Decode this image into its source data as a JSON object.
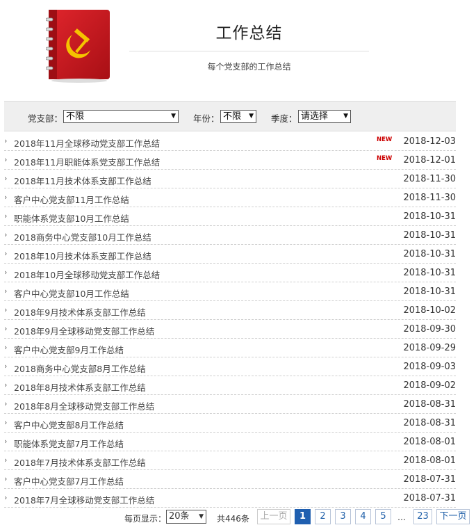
{
  "header": {
    "title": "工作总结",
    "subtitle": "每个党支部的工作总结",
    "logo_icon": "red-notebook-hammer-sickle-icon"
  },
  "filters": {
    "branch_label": "党支部：",
    "branch_value": "不限",
    "year_label": "年份：",
    "year_value": "不限",
    "quarter_label": "季度：",
    "quarter_value": "请选择"
  },
  "new_badge": "NEW",
  "rows": [
    {
      "title": "2018年11月全球移动党支部工作总结",
      "date": "2018-12-03",
      "new": true
    },
    {
      "title": "2018年11月职能体系党支部工作总结",
      "date": "2018-12-01",
      "new": true
    },
    {
      "title": "2018年11月技术体系支部工作总结",
      "date": "2018-11-30",
      "new": false
    },
    {
      "title": "客户中心党支部11月工作总结",
      "date": "2018-11-30",
      "new": false
    },
    {
      "title": "职能体系党支部10月工作总结",
      "date": "2018-10-31",
      "new": false
    },
    {
      "title": "2018商务中心党支部10月工作总结",
      "date": "2018-10-31",
      "new": false
    },
    {
      "title": "2018年10月技术体系支部工作总结",
      "date": "2018-10-31",
      "new": false
    },
    {
      "title": "2018年10月全球移动党支部工作总结",
      "date": "2018-10-31",
      "new": false
    },
    {
      "title": "客户中心党支部10月工作总结",
      "date": "2018-10-31",
      "new": false
    },
    {
      "title": "2018年9月技术体系支部工作总结",
      "date": "2018-10-02",
      "new": false
    },
    {
      "title": "2018年9月全球移动党支部工作总结",
      "date": "2018-09-30",
      "new": false
    },
    {
      "title": "客户中心党支部9月工作总结",
      "date": "2018-09-29",
      "new": false
    },
    {
      "title": "2018商务中心党支部8月工作总结",
      "date": "2018-09-03",
      "new": false
    },
    {
      "title": "2018年8月技术体系支部工作总结",
      "date": "2018-09-02",
      "new": false
    },
    {
      "title": "2018年8月全球移动党支部工作总结",
      "date": "2018-08-31",
      "new": false
    },
    {
      "title": "客户中心党支部8月工作总结",
      "date": "2018-08-31",
      "new": false
    },
    {
      "title": "职能体系党支部7月工作总结",
      "date": "2018-08-01",
      "new": false
    },
    {
      "title": "2018年7月技术体系支部工作总结",
      "date": "2018-08-01",
      "new": false
    },
    {
      "title": "客户中心党支部7月工作总结",
      "date": "2018-07-31",
      "new": false
    },
    {
      "title": "2018年7月全球移动党支部工作总结",
      "date": "2018-07-31",
      "new": false
    }
  ],
  "pagination": {
    "per_page_label": "每页显示：",
    "per_page_value": "20条",
    "total_text": "共446条",
    "prev_label": "上一页",
    "next_label": "下一页",
    "pages": [
      "1",
      "2",
      "3",
      "4",
      "5"
    ],
    "ellipsis": "…",
    "last_page": "23",
    "current_page": "1"
  },
  "colors": {
    "accent": "#1f5fb0",
    "new_badge": "#cc0000",
    "logo_red": "#c8141c"
  }
}
